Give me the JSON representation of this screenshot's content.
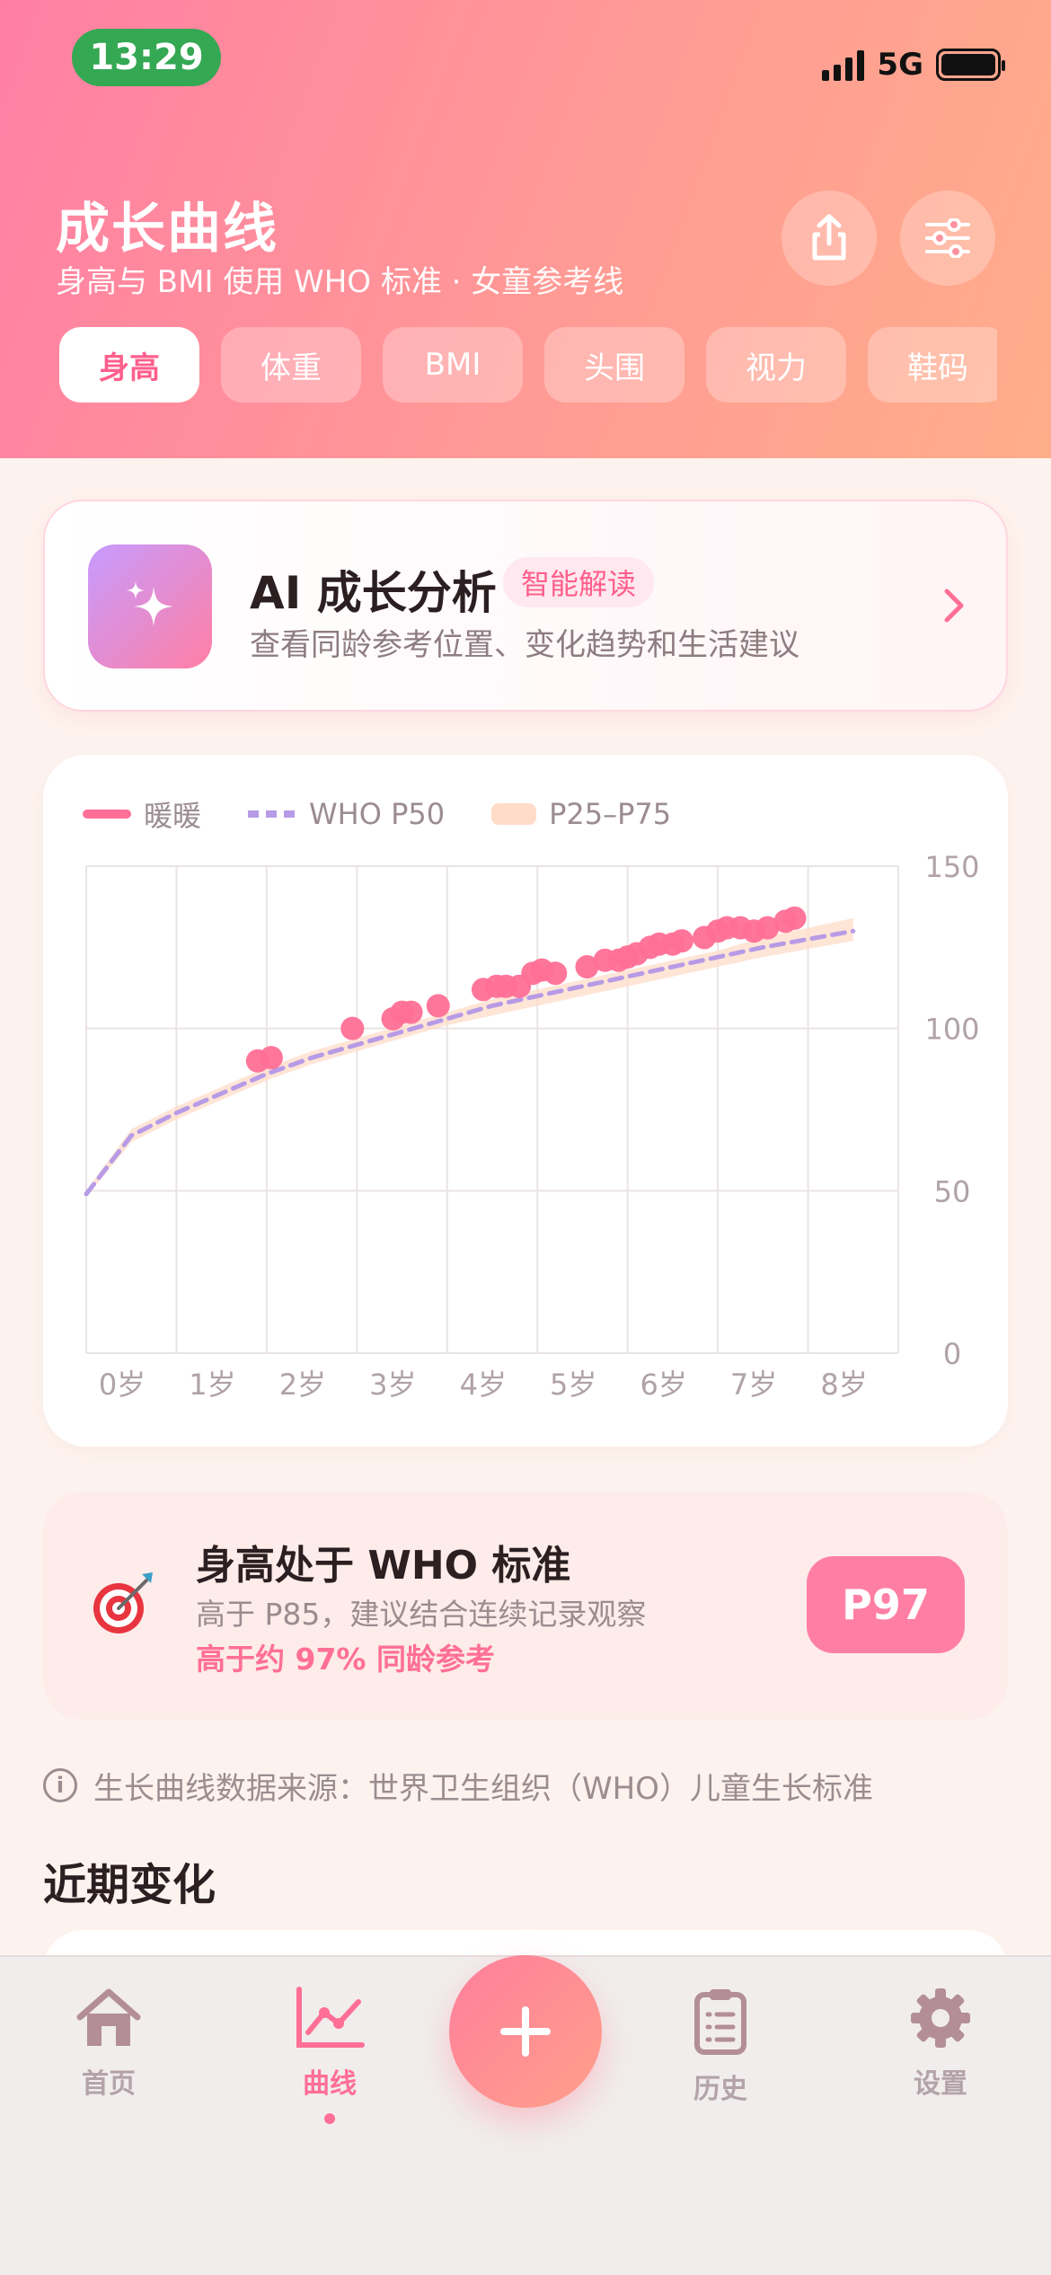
{
  "status_bar": {
    "time": "13:29",
    "network": "5G"
  },
  "header": {
    "title": "成长曲线",
    "subtitle": "身高与 BMI 使用 WHO 标准 · 女童参考线",
    "tabs": [
      {
        "label": "身高",
        "active": true
      },
      {
        "label": "体重",
        "active": false
      },
      {
        "label": "BMI",
        "active": false
      },
      {
        "label": "头围",
        "active": false
      },
      {
        "label": "视力",
        "active": false
      },
      {
        "label": "鞋码",
        "active": false
      }
    ],
    "share_icon": "share-icon",
    "filter_icon": "sliders-icon"
  },
  "ai_card": {
    "title": "AI 成长分析",
    "badge": "智能解读",
    "description": "查看同龄参考位置、变化趋势和生活建议",
    "icon": "sparkle-icon"
  },
  "chart_data": {
    "type": "line",
    "legend": [
      "暖暖",
      "WHO P50",
      "P25–P75"
    ],
    "x_tick_labels": [
      "0岁",
      "1岁",
      "2岁",
      "3岁",
      "4岁",
      "5岁",
      "6岁",
      "7岁",
      "8岁"
    ],
    "xlim": [
      0,
      9
    ],
    "ylim": [
      0,
      150
    ],
    "y_ticks": [
      0,
      50,
      100,
      150
    ],
    "y_axis_position": "right",
    "grid": true,
    "colors": {
      "child": "#ff6f96",
      "p50": "#b79be6",
      "band": "#ffdcc8"
    },
    "series": [
      {
        "name": "暖暖",
        "kind": "scatter",
        "x": [
          1.9,
          2.05,
          2.95,
          3.4,
          3.5,
          3.6,
          3.9,
          4.4,
          4.55,
          4.65,
          4.8,
          4.95,
          5.05,
          5.2,
          5.55,
          5.75,
          5.9,
          6.0,
          6.1,
          6.25,
          6.35,
          6.5,
          6.6,
          6.85,
          7.0,
          7.1,
          7.25,
          7.4,
          7.55,
          7.75,
          7.85
        ],
        "y": [
          90,
          91,
          100,
          103,
          105,
          105,
          107,
          112,
          113,
          113,
          113,
          117,
          118,
          117,
          119,
          121,
          121,
          122,
          123,
          125,
          126,
          126,
          127,
          128,
          130,
          131,
          131,
          130,
          131,
          133,
          134
        ]
      },
      {
        "name": "WHO P50",
        "kind": "line",
        "x": [
          0,
          0.5,
          1,
          1.5,
          2,
          2.5,
          3,
          3.5,
          4,
          4.5,
          5,
          5.5,
          6,
          6.5,
          7,
          7.5,
          8.5
        ],
        "y": [
          49,
          67,
          74,
          80,
          86,
          91,
          95,
          99,
          103,
          107,
          110,
          113,
          116,
          119,
          122,
          125,
          130
        ]
      },
      {
        "name": "P25–P75",
        "kind": "band",
        "x": [
          0,
          0.5,
          1,
          1.5,
          2,
          2.5,
          3,
          3.5,
          4,
          4.5,
          5,
          5.5,
          6,
          6.5,
          7,
          7.5,
          8.5
        ],
        "low": [
          48,
          65,
          72,
          78,
          84,
          89,
          93,
          97,
          101,
          104,
          107,
          110,
          113,
          116,
          119,
          122,
          127
        ],
        "high": [
          50,
          69,
          76,
          82,
          88,
          93,
          97,
          101,
          105,
          109,
          112,
          115,
          118,
          121,
          124,
          128,
          134
        ]
      }
    ]
  },
  "status_card": {
    "title": "身高处于 WHO 标准",
    "subtitle": "高于 P85，建议结合连续记录观察",
    "emphasis": "高于约 97% 同龄参考",
    "badge": "P97",
    "icon": "target-icon"
  },
  "source_note": "生长曲线数据来源：世界卫生组织（WHO）儿童生长标准",
  "recent_section_title": "近期变化",
  "bottom_nav": {
    "items": [
      {
        "label": "首页",
        "icon": "home-icon",
        "active": false
      },
      {
        "label": "曲线",
        "icon": "chart-icon",
        "active": true
      },
      {
        "label": "历史",
        "icon": "clipboard-icon",
        "active": false
      },
      {
        "label": "设置",
        "icon": "gear-icon",
        "active": false
      }
    ],
    "fab_icon": "plus-icon"
  }
}
